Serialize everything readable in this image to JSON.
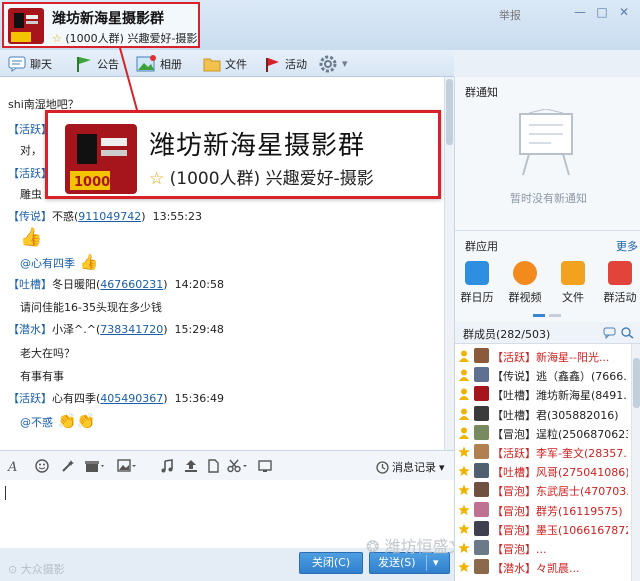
{
  "group": {
    "name": "潍坊新海星摄影群",
    "subtitle": "(1000人群) 兴趣爱好-摄影",
    "logo_text": "1000"
  },
  "titlebar": {
    "report": "举报",
    "btn_restore": "□",
    "btn_minimize": "—",
    "btn_close": "✕"
  },
  "toolbar": {
    "items": [
      {
        "label": "聊天",
        "icon": "chat-bubble-icon"
      },
      {
        "label": "公告",
        "icon": "flag-icon"
      },
      {
        "label": "相册",
        "icon": "photo-icon"
      },
      {
        "label": "文件",
        "icon": "folder-icon"
      },
      {
        "label": "活动",
        "icon": "pin-flag-icon"
      },
      {
        "label": "",
        "icon": "gear-icon"
      }
    ],
    "settings_arrow": "▾"
  },
  "chat": {
    "lines": [
      {
        "type": "message",
        "text": "shi南湿地吧？"
      },
      {
        "type": "header",
        "badge": "【活跃】",
        "name": "",
        "qq": "",
        "time": ""
      },
      {
        "type": "message",
        "text": "对，"
      },
      {
        "type": "header",
        "badge": "【活跃】",
        "name": "",
        "qq": "",
        "time": ""
      },
      {
        "type": "message",
        "text": "雕虫"
      },
      {
        "type": "header",
        "badge": "【传说】",
        "name": "不惑",
        "qq": "911049742",
        "time": "13:55:23"
      },
      {
        "type": "emoji",
        "text": "👍"
      },
      {
        "type": "mention",
        "at": "@心有四季",
        "text": " 👍"
      },
      {
        "type": "header",
        "badge": "【吐槽】",
        "name": "冬日暖阳",
        "qq": "467660231",
        "time": "14:20:58"
      },
      {
        "type": "message",
        "text": "请问佳能16-35头现在多少钱"
      },
      {
        "type": "header",
        "badge": "【潜水】",
        "name": "小泽^.^",
        "qq": "738341720",
        "time": "15:29:48"
      },
      {
        "type": "message",
        "text": "老大在吗？"
      },
      {
        "type": "message",
        "text": "有事有事"
      },
      {
        "type": "header",
        "badge": "【活跃】",
        "name": "心有四季",
        "qq": "405490367",
        "time": "15:36:49"
      },
      {
        "type": "mention",
        "at": "@不惑",
        "text": " 👏👏"
      }
    ]
  },
  "input_toolbar": {
    "icons": [
      "font-icon",
      "emoji-icon",
      "magic-icon",
      "gift-icon",
      "image-icon",
      "music-icon",
      "upload-icon",
      "file-icon",
      "scissors-icon",
      "screen-icon"
    ],
    "history_label": "消息记录",
    "history_arrow": "▾"
  },
  "bottom": {
    "close_label": "关闭(C)",
    "send_label": "发送(S)",
    "send_arrow": "▾",
    "watermark_left": "大众摄影",
    "watermark_right": "潍坊恒盛文商贸有限公司"
  },
  "notice": {
    "title": "群通知",
    "empty_text": "暂时没有新通知"
  },
  "apps": {
    "title": "群应用",
    "more": "更多",
    "items": [
      {
        "label": "群日历",
        "color": "#2e8fe0"
      },
      {
        "label": "群视频",
        "color": "#f28a1e"
      },
      {
        "label": "文件",
        "color": "#f2a21e"
      },
      {
        "label": "群活动",
        "color": "#e0443a"
      }
    ]
  },
  "members": {
    "title": "群成员(282/503)",
    "list": [
      {
        "text": "【活跃】新海星--阳光...",
        "color": "#d02020",
        "crown": "person",
        "avatar": "#8a5a3a"
      },
      {
        "text": "【传说】逃（鑫鑫）(7666...",
        "color": "#222222",
        "crown": "person",
        "avatar": "#607090"
      },
      {
        "text": "【吐槽】潍坊新海星(8491...",
        "color": "#222222",
        "crown": "person",
        "avatar": "#a7151c"
      },
      {
        "text": "【吐槽】君(305882016)",
        "color": "#222222",
        "crown": "person",
        "avatar": "#3a3a3a"
      },
      {
        "text": "【冒泡】逞粒(2506870623)",
        "color": "#222222",
        "crown": "person",
        "avatar": "#7a8a60"
      },
      {
        "text": "【活跃】李军-奎文(28357...",
        "color": "#d02020",
        "crown": "star",
        "avatar": "#b08050"
      },
      {
        "text": "【吐槽】风哥(275041086)",
        "color": "#d02020",
        "crown": "star",
        "avatar": "#506070"
      },
      {
        "text": "【冒泡】东武居士(470703...",
        "color": "#d02020",
        "crown": "star",
        "avatar": "#705040"
      },
      {
        "text": "【冒泡】群芳(16119575)",
        "color": "#d02020",
        "crown": "star",
        "avatar": "#c07090"
      },
      {
        "text": "【冒泡】墨玉(1066167872)",
        "color": "#d02020",
        "crown": "star",
        "avatar": "#404050"
      },
      {
        "text": "【冒泡】...",
        "color": "#d02020",
        "crown": "star",
        "avatar": "#6a7a8a"
      },
      {
        "text": "【潜水】々凯晨... ",
        "color": "#d02020",
        "crown": "star",
        "avatar": "#8a6a4a"
      }
    ]
  }
}
